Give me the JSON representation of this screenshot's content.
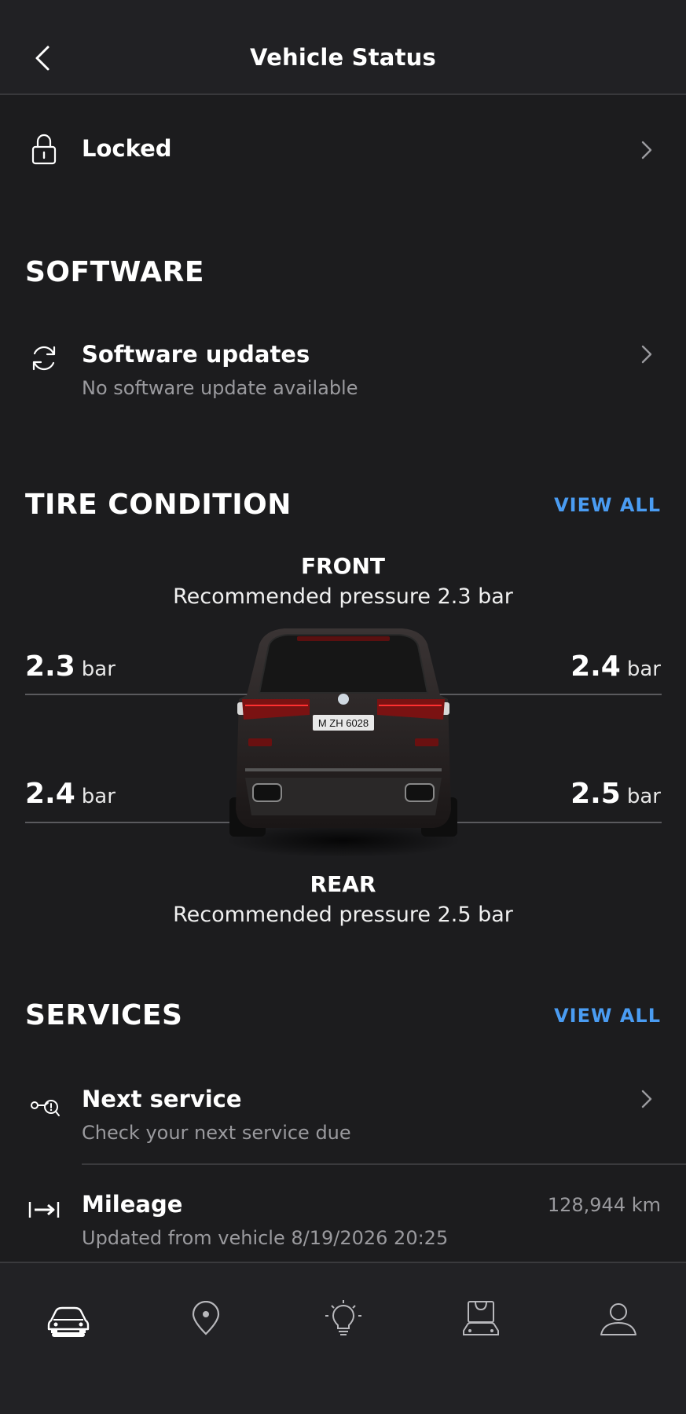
{
  "header": {
    "title": "Vehicle Status"
  },
  "lock": {
    "label": "Locked"
  },
  "software": {
    "section_title": "SOFTWARE",
    "item_title": "Software updates",
    "item_subtitle": "No software update available"
  },
  "tires": {
    "section_title": "TIRE CONDITION",
    "view_all": "VIEW ALL",
    "front_label": "FRONT",
    "front_recommended": "Recommended pressure 2.3 bar",
    "rear_label": "REAR",
    "rear_recommended": "Recommended pressure 2.5 bar",
    "unit": "bar",
    "front_left": "2.3",
    "front_right": "2.4",
    "rear_left": "2.4",
    "rear_right": "2.5",
    "plate": "M ZH 6028"
  },
  "services": {
    "section_title": "SERVICES",
    "view_all": "VIEW ALL",
    "next_title": "Next service",
    "next_subtitle": "Check your next service due",
    "mileage_title": "Mileage",
    "mileage_subtitle": "Updated from vehicle 8/19/2026 20:25",
    "mileage_value": "128,944 km"
  },
  "tabs": [
    {
      "icon": "car-icon"
    },
    {
      "icon": "location-pin-icon"
    },
    {
      "icon": "lightbulb-icon"
    },
    {
      "icon": "shop-car-icon"
    },
    {
      "icon": "profile-icon"
    }
  ],
  "colors": {
    "accent": "#4a9cf2",
    "background": "#1c1c1e",
    "header": "#212124"
  }
}
